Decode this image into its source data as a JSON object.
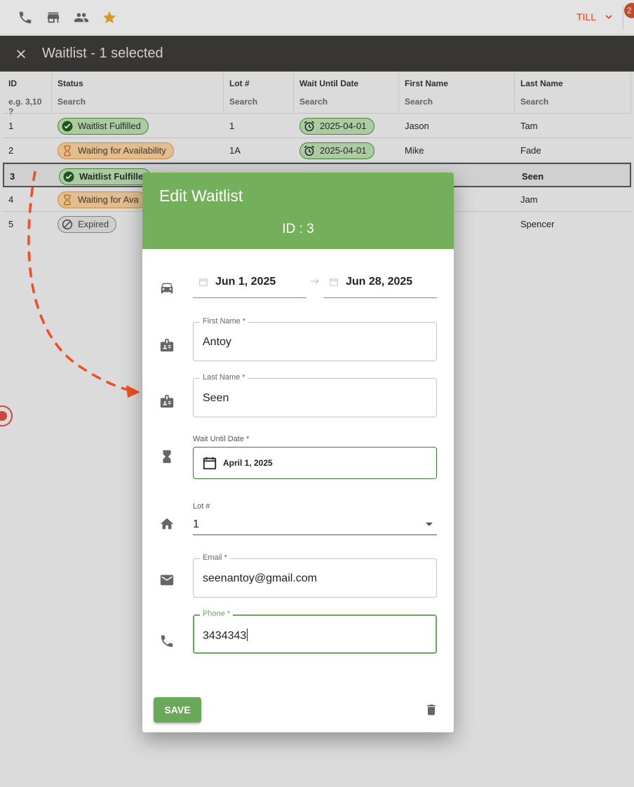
{
  "topbar": {
    "icons": [
      "phone-icon",
      "store-icon",
      "people-icon",
      "star-icon"
    ],
    "user_label": "TILL",
    "notification_count": "2"
  },
  "selection_bar": {
    "title": "Waitlist",
    "selected_text": " - 1 selected"
  },
  "table": {
    "columns": [
      {
        "label": "ID",
        "filter": "e.g. 3,10 ?"
      },
      {
        "label": "Status",
        "filter": "Search"
      },
      {
        "label": "Lot #",
        "filter": "Search"
      },
      {
        "label": "Wait Until Date",
        "filter": "Search"
      },
      {
        "label": "First Name",
        "filter": "Search"
      },
      {
        "label": "Last Name",
        "filter": "Search"
      }
    ],
    "rows": [
      {
        "id": "1",
        "status": "Waitlist Fulfilled",
        "lot": "1",
        "date": "2025-04-01",
        "first": "Jason",
        "last": "Tam"
      },
      {
        "id": "2",
        "status": "Waiting for Availability",
        "lot": "1A",
        "date": "2025-04-01",
        "first": "Mike",
        "last": "Fade"
      },
      {
        "id": "3",
        "status": "Waitlist Fulfille",
        "lot": "",
        "date": "",
        "first": "",
        "last": "Seen"
      },
      {
        "id": "4",
        "status": "Waiting for Ava",
        "lot": "",
        "date": "",
        "first": "",
        "last": "Jam"
      },
      {
        "id": "5",
        "status": "Expired",
        "lot": "",
        "date": "",
        "first": "",
        "last": "Spencer"
      }
    ]
  },
  "dialog": {
    "title": "Edit Waitlist",
    "id_label": "ID : 3",
    "date_start": "Jun 1, 2025",
    "date_end": "Jun 28, 2025",
    "first_name_label": "First Name *",
    "first_name_value": "Antoy",
    "last_name_label": "Last Name *",
    "last_name_value": "Seen",
    "wait_until_label": "Wait Until Date *",
    "wait_until_value": "April 1, 2025",
    "lot_label": "Lot #",
    "lot_value": "1",
    "email_label": "Email *",
    "email_value": "seenantoy@gmail.com",
    "phone_label": "Phone *",
    "phone_value": "3434343",
    "save_label": "SAVE"
  },
  "colors": {
    "accent_green": "#74b05c",
    "selection_bar": "#3b3a36",
    "annotation_arrow": "#f04e23"
  }
}
